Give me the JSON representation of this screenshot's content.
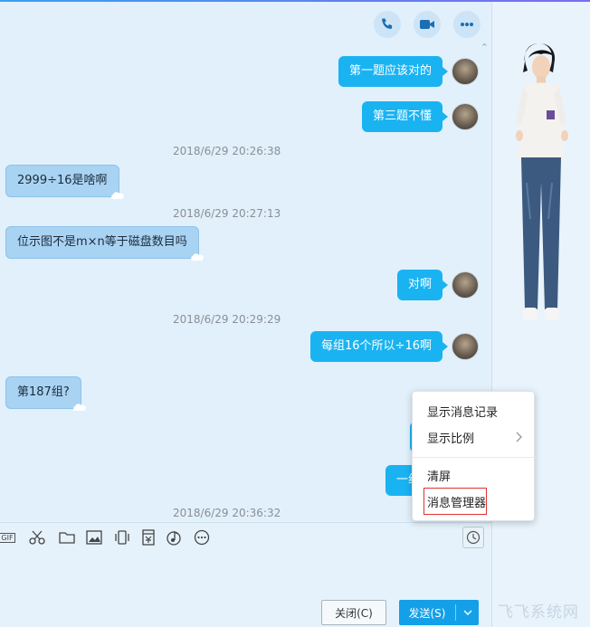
{
  "header": {
    "call_icon": "phone-icon",
    "video_icon": "video-camera-icon",
    "more_icon": "more-dots-icon"
  },
  "messages": [
    {
      "side": "me",
      "text": "第一题应该对的"
    },
    {
      "side": "me",
      "text": "第三题不懂"
    },
    {
      "side": "time",
      "text": "2018/6/29 20:26:38"
    },
    {
      "side": "other",
      "text": "2999÷16是啥啊"
    },
    {
      "side": "time",
      "text": "2018/6/29 20:27:13"
    },
    {
      "side": "other",
      "text": "位示图不是m×n等于磁盘数目吗"
    },
    {
      "side": "me",
      "text": "对啊"
    },
    {
      "side": "time",
      "text": "2018/6/29 20:29:29"
    },
    {
      "side": "me",
      "text": "每组16个所以÷16啊"
    },
    {
      "side": "other",
      "text": "第187组?"
    },
    {
      "side": "me",
      "text": "一组一"
    },
    {
      "side": "time",
      "text": "2018/6/29 20:36:32"
    }
  ],
  "toolbar": {
    "icons": [
      "gif-icon",
      "scissors-icon",
      "folder-icon",
      "image-icon",
      "shake-icon",
      "red-packet-icon",
      "music-icon",
      "more-circle-icon"
    ],
    "gif_label": "GIF",
    "history_icon": "clock-icon"
  },
  "buttons": {
    "close_label": "关闭(C)",
    "send_label": "发送(S)"
  },
  "context_menu": {
    "items": [
      "显示消息记录",
      "显示比例",
      "清屏",
      "消息管理器"
    ],
    "highlighted_item": "消息管理器"
  },
  "watermark": "飞飞系统网",
  "colors": {
    "my_bubble": "#1ab3f2",
    "other_bubble": "#a9d3f3",
    "send_button": "#14a0e9",
    "highlight": "#dd3333"
  }
}
